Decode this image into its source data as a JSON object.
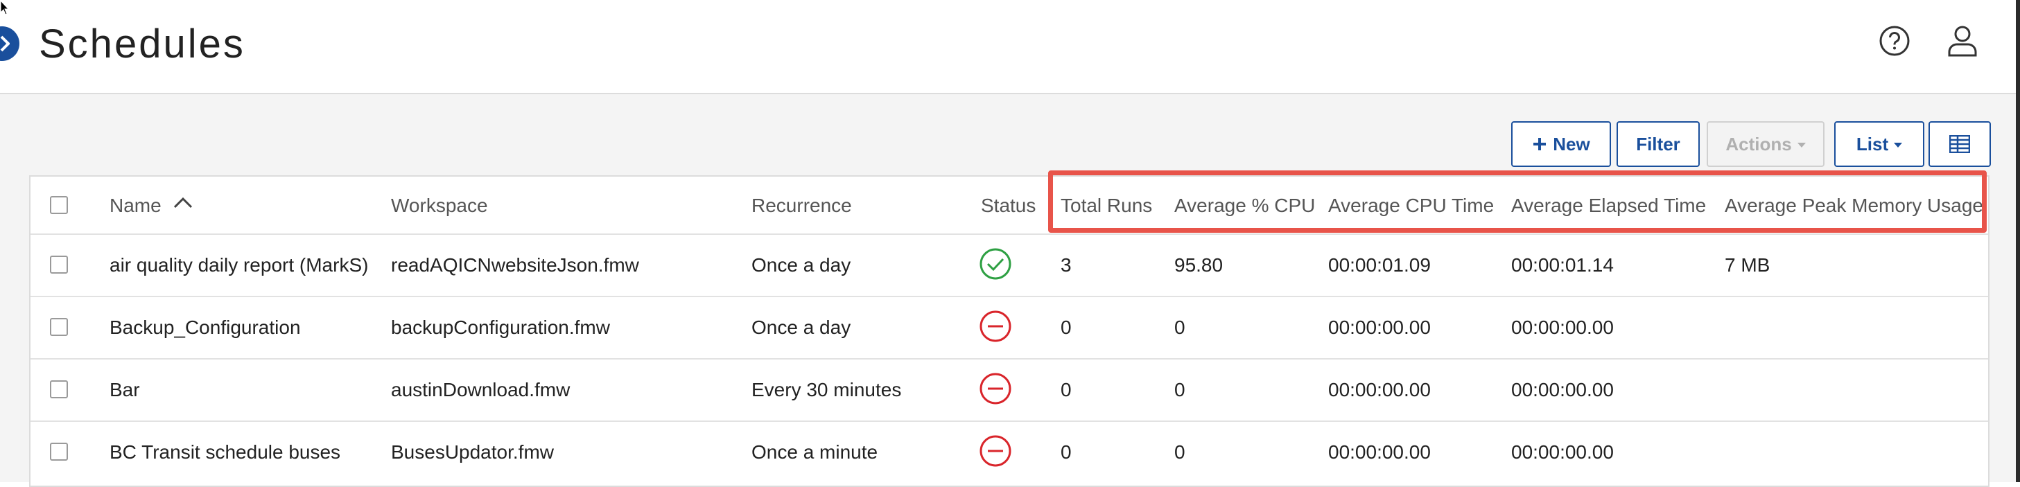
{
  "header": {
    "title": "Schedules"
  },
  "toolbar": {
    "new_label": "New",
    "filter_label": "Filter",
    "actions_label": "Actions",
    "list_label": "List"
  },
  "table": {
    "columns": [
      "Name",
      "Workspace",
      "Recurrence",
      "Status",
      "Total Runs",
      "Average % CPU",
      "Average CPU Time",
      "Average Elapsed Time",
      "Average Peak Memory Usage"
    ],
    "sort_column": "Name",
    "sort_direction": "ascending",
    "rows": [
      {
        "name": "air quality daily report (MarkS)",
        "workspace": "readAQICNwebsiteJson.fmw",
        "recurrence": "Once a day",
        "status": "success",
        "total_runs": "3",
        "avg_cpu": "95.80",
        "avg_cpu_time": "00:00:01.09",
        "avg_elapsed": "00:00:01.14",
        "avg_peak_mem": "7 MB"
      },
      {
        "name": "Backup_Configuration",
        "workspace": "backupConfiguration.fmw",
        "recurrence": "Once a day",
        "status": "disabled",
        "total_runs": "0",
        "avg_cpu": "0",
        "avg_cpu_time": "00:00:00.00",
        "avg_elapsed": "00:00:00.00",
        "avg_peak_mem": ""
      },
      {
        "name": "Bar",
        "workspace": "austinDownload.fmw",
        "recurrence": "Every 30 minutes",
        "status": "disabled",
        "total_runs": "0",
        "avg_cpu": "0",
        "avg_cpu_time": "00:00:00.00",
        "avg_elapsed": "00:00:00.00",
        "avg_peak_mem": ""
      },
      {
        "name": "BC Transit schedule buses",
        "workspace": "BusesUpdator.fmw",
        "recurrence": "Once a minute",
        "status": "disabled",
        "total_runs": "0",
        "avg_cpu": "0",
        "avg_cpu_time": "00:00:00.00",
        "avg_elapsed": "00:00:00.00",
        "avg_peak_mem": ""
      }
    ]
  },
  "colors": {
    "accent": "#1a4f9c",
    "success": "#2ea043",
    "error": "#d9252b",
    "highlight": "#e8544a"
  }
}
